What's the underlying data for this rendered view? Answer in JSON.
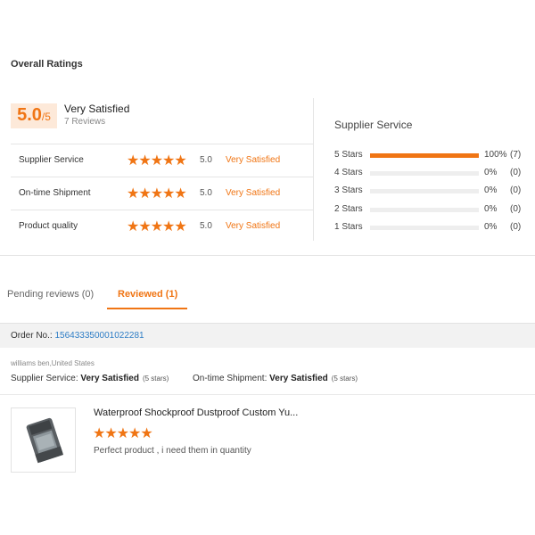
{
  "overall": {
    "title": "Overall Ratings",
    "score": "5.0",
    "score_max": "/5",
    "label": "Very Satisfied",
    "count": "7 Reviews"
  },
  "ratings": [
    {
      "name": "Supplier Service",
      "stars": "★★★★★",
      "score": "5.0",
      "text": "Very Satisfied"
    },
    {
      "name": "On-time Shipment",
      "stars": "★★★★★",
      "score": "5.0",
      "text": "Very Satisfied"
    },
    {
      "name": "Product quality",
      "stars": "★★★★★",
      "score": "5.0",
      "text": "Very Satisfied"
    }
  ],
  "supplier_breakdown": {
    "title": "Supplier Service",
    "rows": [
      {
        "label": "5 Stars",
        "fraction": 1.0,
        "pct": "100%",
        "count": "(7)"
      },
      {
        "label": "4 Stars",
        "fraction": 0.0,
        "pct": "0%",
        "count": "(0)"
      },
      {
        "label": "3 Stars",
        "fraction": 0.0,
        "pct": "0%",
        "count": "(0)"
      },
      {
        "label": "2 Stars",
        "fraction": 0.0,
        "pct": "0%",
        "count": "(0)"
      },
      {
        "label": "1 Stars",
        "fraction": 0.0,
        "pct": "0%",
        "count": "(0)"
      }
    ]
  },
  "tabs": [
    {
      "label": "Pending reviews (0)"
    },
    {
      "label": "Reviewed (1)"
    }
  ],
  "order": {
    "label": "Order No.: ",
    "number": "156433350001022281"
  },
  "review": {
    "reviewer": "williams ben,United States",
    "supplier_label": "Supplier Service: ",
    "supplier_value": "Very Satisfied",
    "supplier_stars": "(5 stars)",
    "shipment_label": "On-time Shipment: ",
    "shipment_value": "Very Satisfied",
    "shipment_stars": "(5 stars)",
    "product_title": "Waterproof Shockproof Dustproof Custom Yu...",
    "product_stars": "★★★★★",
    "comment": "Perfect product , i need them in quantity"
  },
  "colors": {
    "accent": "#f07514",
    "link": "#2f7ec6"
  }
}
